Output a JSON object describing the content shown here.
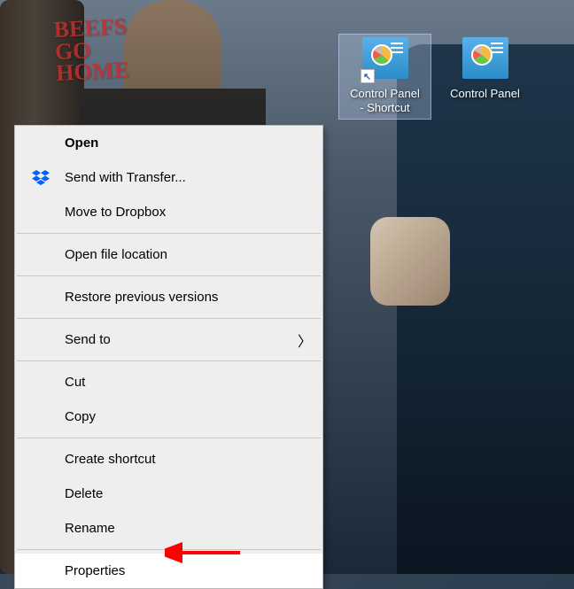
{
  "graffiti": "BEEFS\nGO\nHOME",
  "desktop_icons": [
    {
      "label": "Control Panel\n- Shortcut",
      "selected": true,
      "shortcut": true
    },
    {
      "label": "Control Panel",
      "selected": false,
      "shortcut": false
    }
  ],
  "context_menu": {
    "items": [
      {
        "label": "Open",
        "bold": true,
        "icon": null
      },
      {
        "label": "Send with Transfer...",
        "icon": "dropbox"
      },
      {
        "label": "Move to Dropbox",
        "icon": null
      },
      "---",
      {
        "label": "Open file location",
        "icon": null
      },
      "---",
      {
        "label": "Restore previous versions",
        "icon": null
      },
      "---",
      {
        "label": "Send to",
        "icon": null,
        "submenu": true
      },
      "---",
      {
        "label": "Cut",
        "icon": null
      },
      {
        "label": "Copy",
        "icon": null
      },
      "---",
      {
        "label": "Create shortcut",
        "icon": null
      },
      {
        "label": "Delete",
        "icon": null
      },
      {
        "label": "Rename",
        "icon": null
      },
      "---",
      {
        "label": "Properties",
        "icon": null,
        "highlighted": true
      }
    ]
  },
  "annotation": {
    "arrow_color": "#ff0000"
  }
}
